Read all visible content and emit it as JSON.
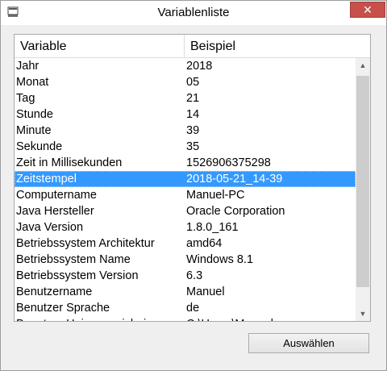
{
  "window": {
    "title": "Variablenliste",
    "icon": "window-app-icon",
    "close_label": "✕"
  },
  "table": {
    "columns": [
      "Variable",
      "Beispiel"
    ],
    "rows": [
      {
        "variable": "Jahr",
        "beispiel": "2018"
      },
      {
        "variable": "Monat",
        "beispiel": "05"
      },
      {
        "variable": "Tag",
        "beispiel": "21"
      },
      {
        "variable": "Stunde",
        "beispiel": "14"
      },
      {
        "variable": "Minute",
        "beispiel": "39"
      },
      {
        "variable": "Sekunde",
        "beispiel": "35"
      },
      {
        "variable": "Zeit in Millisekunden",
        "beispiel": "1526906375298"
      },
      {
        "variable": "Zeitstempel",
        "beispiel": "2018-05-21_14-39",
        "selected": true
      },
      {
        "variable": "Computername",
        "beispiel": "Manuel-PC"
      },
      {
        "variable": "Java Hersteller",
        "beispiel": "Oracle Corporation"
      },
      {
        "variable": "Java Version",
        "beispiel": "1.8.0_161"
      },
      {
        "variable": "Betriebssystem Architektur",
        "beispiel": "amd64"
      },
      {
        "variable": "Betriebssystem Name",
        "beispiel": "Windows 8.1"
      },
      {
        "variable": "Betriebssystem Version",
        "beispiel": "6.3"
      },
      {
        "variable": "Benutzername",
        "beispiel": "Manuel"
      },
      {
        "variable": "Benutzer Sprache",
        "beispiel": "de"
      },
      {
        "variable": "Benutzer Heimverzeichnis",
        "beispiel": "C:\\Users\\Manuel"
      }
    ]
  },
  "scrollbar": {
    "up_arrow": "▲",
    "down_arrow": "▼"
  },
  "actions": {
    "select_label": "Auswählen"
  },
  "colors": {
    "selection": "#3399ff",
    "close_button": "#c7504a"
  }
}
